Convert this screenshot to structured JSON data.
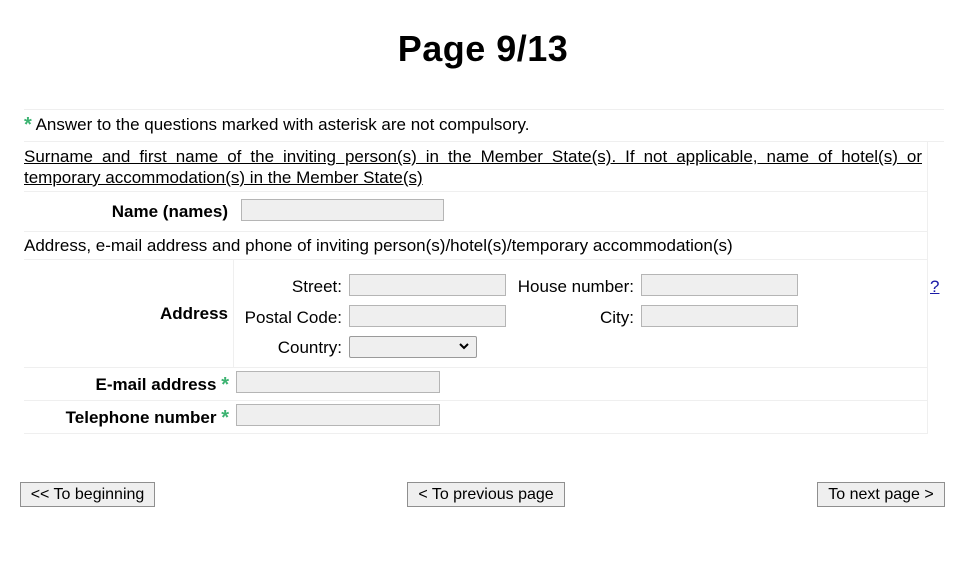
{
  "page": {
    "title": "Page 9/13"
  },
  "note": {
    "asterisk": "*",
    "text": "Answer to the questions marked with asterisk are not compulsory."
  },
  "inviting_section": {
    "heading": "Surname and first name of the inviting person(s) in the Member State(s). If not applicable, name of hotel(s) or temporary accommodation(s) in the Member State(s)",
    "name_label": "Name (names)",
    "name_value": ""
  },
  "address_section": {
    "heading": "Address, e-mail address and phone of inviting person(s)/hotel(s)/temporary accommodation(s)",
    "address_label": "Address",
    "street_label": "Street:",
    "street_value": "",
    "house_number_label": "House number:",
    "house_number_value": "",
    "postal_code_label": "Postal Code:",
    "postal_code_value": "",
    "city_label": "City:",
    "city_value": "",
    "country_label": "Country:",
    "country_value": "",
    "help_link": "?"
  },
  "contact": {
    "email_label": "E-mail address",
    "email_value": "",
    "telephone_label": "Telephone number",
    "telephone_value": "",
    "asterisk": "*"
  },
  "nav": {
    "beginning": "<< To beginning",
    "previous": "< To previous page",
    "next": "To next page >"
  },
  "colors": {
    "asterisk": "#3cb371",
    "input_bg": "#efefef",
    "link": "#1a1aa6"
  }
}
